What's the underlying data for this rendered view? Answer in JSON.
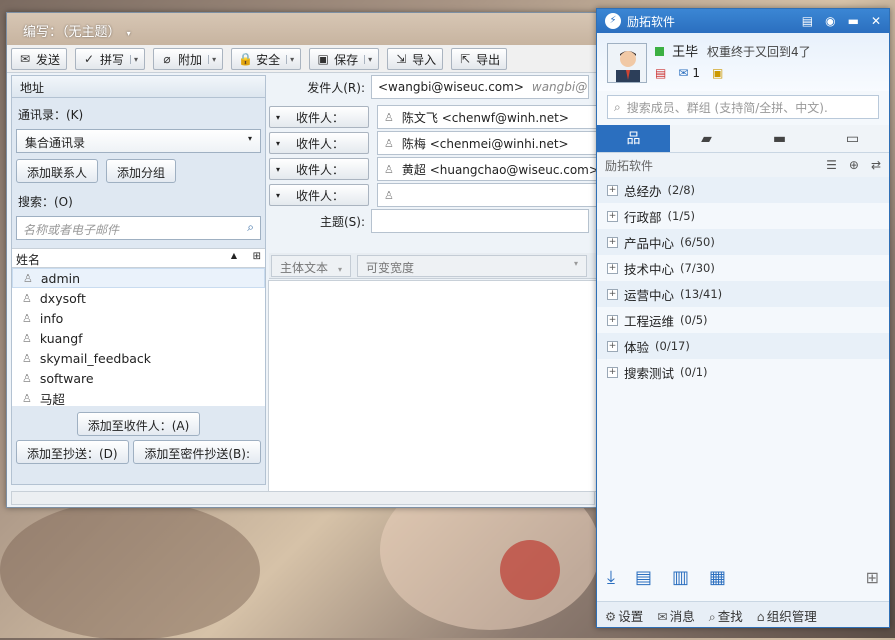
{
  "compose": {
    "title": "编写：（无主题）",
    "toolbar": [
      {
        "label": "发送",
        "icon": "send-icon",
        "glyph": "✉",
        "dropdown": false
      },
      {
        "label": "拼写",
        "icon": "spell-check-icon",
        "glyph": "✓",
        "dropdown": true
      },
      {
        "label": "附加",
        "icon": "paperclip-icon",
        "glyph": "⌀",
        "dropdown": true
      },
      {
        "label": "安全",
        "icon": "lock-icon",
        "glyph": "🔒",
        "dropdown": true
      },
      {
        "label": "保存",
        "icon": "save-icon",
        "glyph": "▣",
        "dropdown": true
      },
      {
        "label": "导入",
        "icon": "import-icon",
        "glyph": "⇲",
        "dropdown": false
      },
      {
        "label": "导出",
        "icon": "export-icon",
        "glyph": "⇱",
        "dropdown": false
      }
    ],
    "contacts": {
      "header": "地址",
      "addressbook_label": "通讯录：(K)",
      "addressbook_value": "集合通讯录",
      "add_contact": "添加联系人",
      "add_group": "添加分组",
      "search_label": "搜索：(O)",
      "search_placeholder": "名称或者电子邮件",
      "list_header": "姓名",
      "items": [
        "admin",
        "dxysoft",
        "info",
        "kuangf",
        "skymail_feedback",
        "software",
        "马超"
      ],
      "add_to_recipients": "添加至收件人：(A)",
      "add_to_cc": "添加至抄送：(D)",
      "add_to_bcc": "添加至密件抄送(B):"
    },
    "from_label": "发件人(R):",
    "from_value": "<wangbi@wiseuc.com>",
    "from_hint": "wangbi@wiseuc.com",
    "recipient_label": "收件人：",
    "recipients": [
      "陈文飞 <chenwf@winh.net>",
      "陈梅 <chenmei@winhi.net>",
      "黄超 <huangchao@wiseuc.com>",
      ""
    ],
    "subject_label": "主题(S):",
    "subject_value": "",
    "format_body": "主体文本",
    "format_width": "可变宽度"
  },
  "im": {
    "title": "励拓软件",
    "user_name": "王毕",
    "signature": "权重终于又回到4了",
    "mail_count": "1",
    "search_placeholder": "搜索成员、群组 (支持简/全拼、中文).",
    "tabs": [
      {
        "icon": "org-tree-icon",
        "glyph": "品"
      },
      {
        "icon": "chat-icon",
        "glyph": "▰"
      },
      {
        "icon": "message-icon",
        "glyph": "▬"
      },
      {
        "icon": "notice-icon",
        "glyph": "▭"
      }
    ],
    "org_name": "励拓软件",
    "groups": [
      {
        "name": "总经办",
        "count": "(2/8)"
      },
      {
        "name": "行政部",
        "count": "(1/5)"
      },
      {
        "name": "产品中心",
        "count": "(6/50)"
      },
      {
        "name": "技术中心",
        "count": "(7/30)"
      },
      {
        "name": "运营中心",
        "count": "(13/41)"
      },
      {
        "name": "工程运维",
        "count": "(0/5)"
      },
      {
        "name": "体验",
        "count": "(0/17)"
      },
      {
        "name": "搜索测试",
        "count": "(0/1)"
      }
    ],
    "footer": [
      {
        "label": "设置",
        "icon": "settings-icon",
        "glyph": "⚙"
      },
      {
        "label": "消息",
        "icon": "messages-icon",
        "glyph": "✉"
      },
      {
        "label": "查找",
        "icon": "find-icon",
        "glyph": "⌕"
      },
      {
        "label": "组织管理",
        "icon": "org-manage-icon",
        "glyph": "⌂"
      }
    ]
  }
}
